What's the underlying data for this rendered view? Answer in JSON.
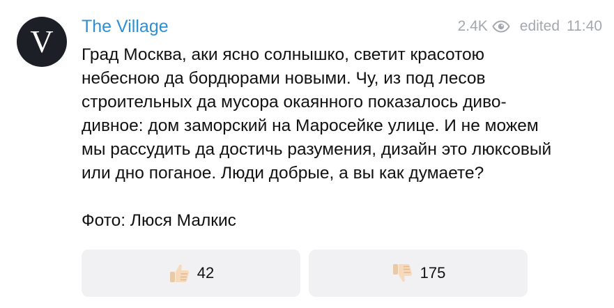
{
  "channel": {
    "avatar_letter": "V",
    "name": "The Village",
    "views": "2.4K",
    "edited_label": "edited",
    "time": "11:40",
    "accent_color": "#2d8fd6"
  },
  "message": {
    "paragraphs": [
      "Град Москва, аки ясно солнышко, светит красотою небесною да бордюрами новыми. Чу, из под лесов строительных да мусора окаянного показалось диво-дивное: дом заморский на Маросейке улице. И не можем мы рассудить да достичь разумения, дизайн это люксовый или дно поганое. Люди добрые, а вы как думаете?",
      "Фото: Люся Малкис"
    ]
  },
  "reactions": [
    {
      "icon": "thumbs-up-icon",
      "count": "42"
    },
    {
      "icon": "thumbs-down-icon",
      "count": "175"
    }
  ]
}
